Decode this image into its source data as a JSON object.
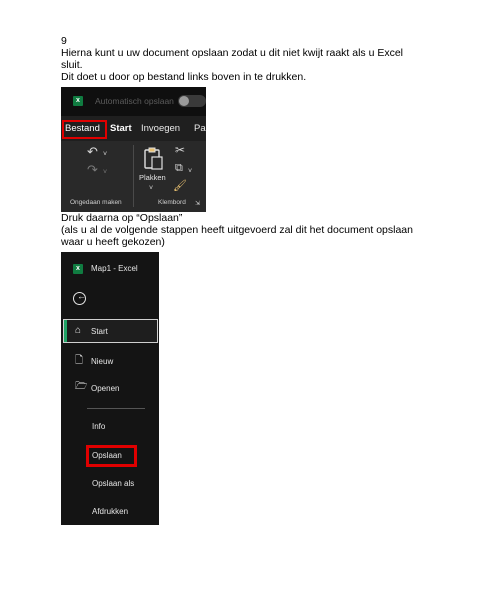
{
  "doc": {
    "step_number": "9",
    "intro_line1": "Hierna kunt u uw document opslaan zodat u dit niet kwijt raakt als u Excel",
    "intro_line2": "sluit.",
    "intro_line3": "Dit doet u door op bestand links boven in te drukken.",
    "press_save": "Druk daarna op “Opslaan”",
    "note_line1": "(als u al de volgende stappen heeft uitgevoerd zal dit het document opslaan",
    "note_line2": "waar u heeft gekozen)"
  },
  "ribbon_screenshot": {
    "app_icon": "excel-icon",
    "app_icon_letter": "x",
    "autosave_label": "Automatisch opslaan",
    "tabs": [
      "Bestand",
      "Start",
      "Invoegen",
      "Pa"
    ],
    "highlighted_tab": "Bestand",
    "groups": [
      {
        "label": "Ongedaan maken",
        "icons": [
          "undo-icon",
          "redo-icon"
        ]
      },
      {
        "label": "Klembord",
        "icons": [
          "paste-icon",
          "cut-icon",
          "copy-icon",
          "format-painter-icon"
        ]
      }
    ],
    "paste_label": "Plakken",
    "highlight_color": "#e00000",
    "excel_green": "#107c41"
  },
  "backstage_screenshot": {
    "title": "Map1  -  Excel",
    "back_icon": "back-arrow-icon",
    "nav": [
      {
        "label": "Start",
        "icon": "home-icon"
      },
      {
        "label": "Nieuw",
        "icon": "new-file-icon"
      },
      {
        "label": "Openen",
        "icon": "open-folder-icon"
      }
    ],
    "sub_nav": [
      "Info",
      "Opslaan",
      "Opslaan als",
      "Afdrukken"
    ],
    "highlighted_item": "Opslaan",
    "active_indicator_color": "#21a366"
  }
}
